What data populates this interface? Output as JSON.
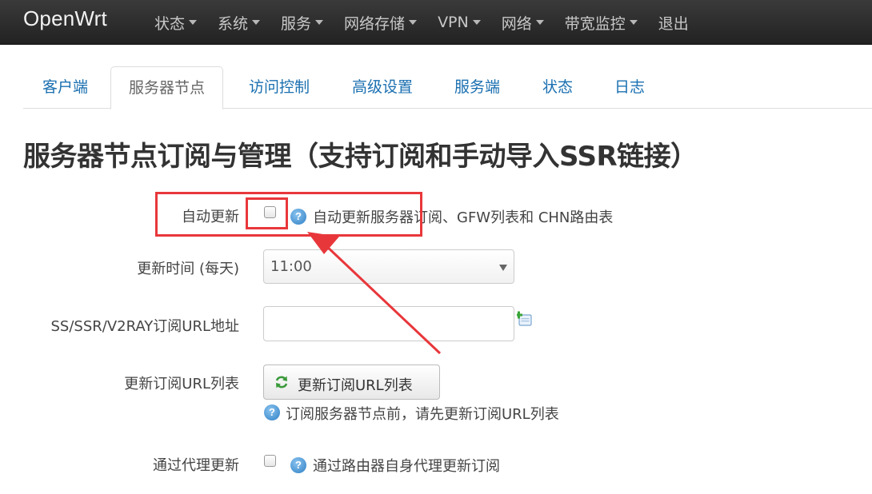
{
  "navbar": {
    "brand": "OpenWrt",
    "items": [
      {
        "label": "状态",
        "has_caret": true
      },
      {
        "label": "系统",
        "has_caret": true
      },
      {
        "label": "服务",
        "has_caret": true
      },
      {
        "label": "网络存储",
        "has_caret": true
      },
      {
        "label": "VPN",
        "has_caret": true
      },
      {
        "label": "网络",
        "has_caret": true
      },
      {
        "label": "带宽监控",
        "has_caret": true
      },
      {
        "label": "退出",
        "has_caret": false
      }
    ]
  },
  "tabs": {
    "items": [
      {
        "label": "客户端"
      },
      {
        "label": "服务器节点",
        "active": true
      },
      {
        "label": "访问控制"
      },
      {
        "label": "高级设置"
      },
      {
        "label": "服务端"
      },
      {
        "label": "状态"
      },
      {
        "label": "日志"
      }
    ]
  },
  "page": {
    "title": "服务器节点订阅与管理（支持订阅和手动导入SSR链接）"
  },
  "form": {
    "auto_update": {
      "label": "自动更新",
      "checked": false,
      "help": "自动更新服务器订阅、GFW列表和 CHN路由表"
    },
    "update_time": {
      "label": "更新时间 (每天)",
      "value": "11:00"
    },
    "subscribe_url": {
      "label": "SS/SSR/V2RAY订阅URL地址",
      "value": ""
    },
    "update_list": {
      "label": "更新订阅URL列表",
      "button_label": "更新订阅URL列表",
      "help": "订阅服务器节点前，请先更新订阅URL列表"
    },
    "proxy_update": {
      "label": "通过代理更新",
      "checked": false,
      "help": "通过路由器自身代理更新订阅"
    }
  },
  "colors": {
    "navbar_bg": "#2b2b2b",
    "link": "#1a6fb0",
    "annotation": "#e8373b"
  }
}
